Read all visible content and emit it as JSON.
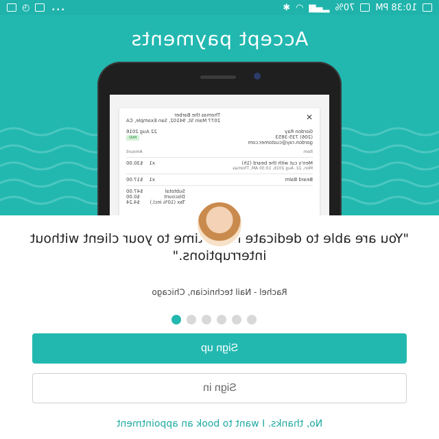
{
  "status_bar": {
    "time": "10:38 PM",
    "battery": "70%",
    "more": "..."
  },
  "hero": {
    "title": "Accept payments",
    "color": "#22b8b0"
  },
  "receipt": {
    "merchant_name": "Thomas the Barber",
    "merchant_address": "2077 Main St, 94102, San Example, CA",
    "customer_name": "Gordon Ray",
    "customer_phone": "(206) 735-3853",
    "customer_email": "gordon.ray@customer.com",
    "date": "22 Aug 2016",
    "paid_label": "PAID",
    "items_header": "Item",
    "amount_header": "Amount",
    "item1_name": "Men's cut with the beard (1h)",
    "item1_detail": "Mon, 22. Aug 2016, 10:30 AM, Thomas",
    "item1_qty": "x1",
    "item1_price": "$30.00",
    "item2_name": "Beard Balm",
    "item2_qty": "x1",
    "item2_price": "$17.00",
    "subtotal_label": "Subtotal",
    "subtotal": "$47.00",
    "discount_label": "Discount",
    "discount": "$0.00",
    "tax_label": "Tax (10% incl.)",
    "tax": "$4.24"
  },
  "testimonial": {
    "quote": "\"You are able to dedicate more time to your client without interruptions.\"",
    "author": "Rachel - Nail technician, Chicago"
  },
  "pager": {
    "count": 6,
    "active_index": 0
  },
  "actions": {
    "signup_label": "Sign up",
    "signin_label": "Sign in",
    "no_thanks_label": "No, thanks. I want to book an appointment"
  }
}
